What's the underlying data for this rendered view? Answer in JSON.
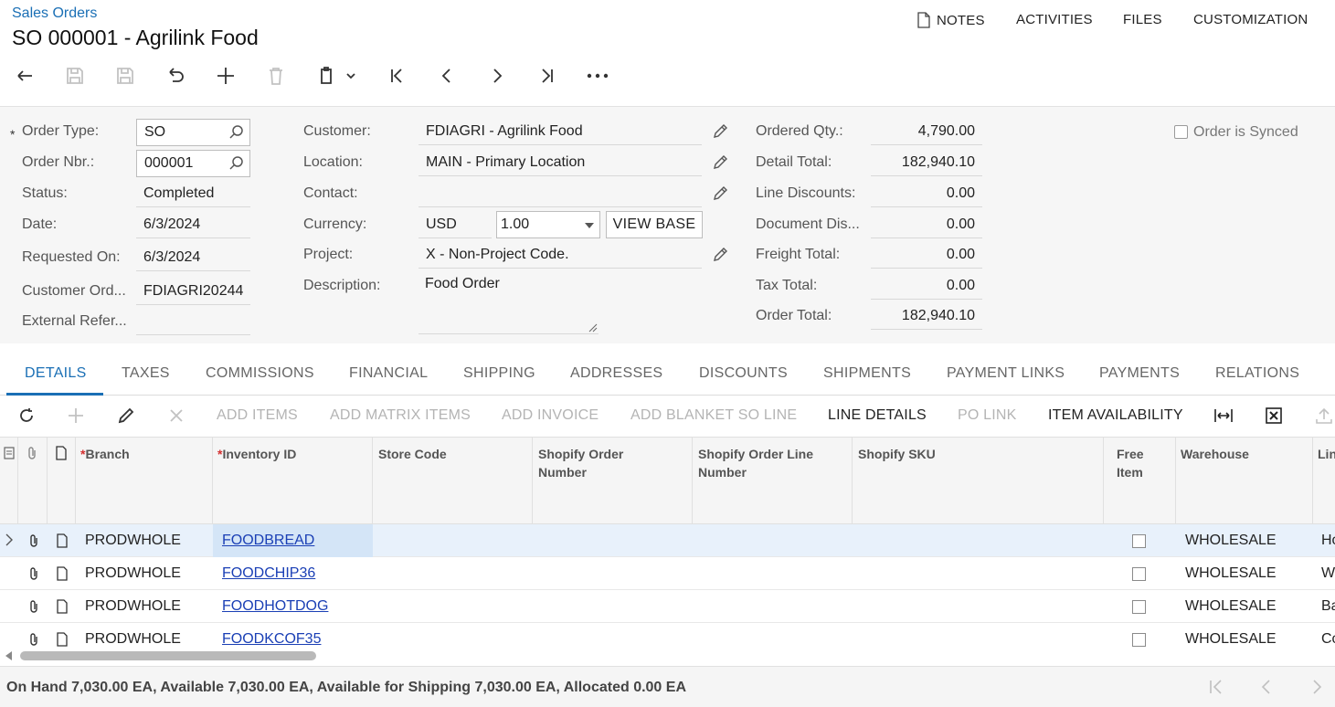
{
  "header": {
    "breadcrumb": "Sales Orders",
    "title": "SO 000001 - Agrilink Food",
    "nav": {
      "notes": "NOTES",
      "activities": "ACTIVITIES",
      "files": "FILES",
      "customization": "CUSTOMIZATION"
    }
  },
  "toolbar": {
    "icons": [
      "back-icon",
      "save-close-icon",
      "save-icon",
      "undo-icon",
      "add-icon",
      "delete-icon",
      "clipboard-icon",
      "first-icon",
      "prev-icon",
      "next-icon",
      "last-icon",
      "more-icon"
    ]
  },
  "form": {
    "order_type": {
      "label": "Order Type:",
      "required": "*",
      "value": "SO"
    },
    "order_nbr": {
      "label": "Order Nbr.:",
      "value": "000001"
    },
    "status": {
      "label": "Status:",
      "value": "Completed"
    },
    "date": {
      "label": "Date:",
      "value": "6/3/2024"
    },
    "requested_on": {
      "label": "Requested On:",
      "value": "6/3/2024"
    },
    "customer_order": {
      "label": "Customer Ord...",
      "value": "FDIAGRI20244"
    },
    "external_ref": {
      "label": "External Refer...",
      "value": ""
    },
    "customer": {
      "label": "Customer:",
      "value": "FDIAGRI - Agrilink Food"
    },
    "location": {
      "label": "Location:",
      "value": "MAIN - Primary Location"
    },
    "contact": {
      "label": "Contact:",
      "value": ""
    },
    "currency": {
      "label": "Currency:",
      "value": "USD",
      "rate": "1.00",
      "view_base": "VIEW BASE"
    },
    "project": {
      "label": "Project:",
      "value": "X - Non-Project Code."
    },
    "description": {
      "label": "Description:",
      "value": "Food Order"
    },
    "ordered_qty": {
      "label": "Ordered Qty.:",
      "value": "4,790.00"
    },
    "detail_total": {
      "label": "Detail Total:",
      "value": "182,940.10"
    },
    "line_discounts": {
      "label": "Line Discounts:",
      "value": "0.00"
    },
    "document_dis": {
      "label": "Document Dis...",
      "value": "0.00"
    },
    "freight_total": {
      "label": "Freight Total:",
      "value": "0.00"
    },
    "tax_total": {
      "label": "Tax Total:",
      "value": "0.00"
    },
    "order_total": {
      "label": "Order Total:",
      "value": "182,940.10"
    },
    "order_synced": {
      "label": "Order is Synced",
      "checked": false
    }
  },
  "tabs": [
    "DETAILS",
    "TAXES",
    "COMMISSIONS",
    "FINANCIAL",
    "SHIPPING",
    "ADDRESSES",
    "DISCOUNTS",
    "SHIPMENTS",
    "PAYMENT LINKS",
    "PAYMENTS",
    "RELATIONS"
  ],
  "active_tab": "DETAILS",
  "grid_toolbar": {
    "add_items": "ADD ITEMS",
    "add_matrix_items": "ADD MATRIX ITEMS",
    "add_invoice": "ADD INVOICE",
    "add_blanket": "ADD BLANKET SO LINE",
    "line_details": "LINE DETAILS",
    "po_link": "PO LINK",
    "item_availability": "ITEM AVAILABILITY"
  },
  "grid": {
    "columns": {
      "branch": "Branch",
      "inventory_id": "Inventory ID",
      "store_code": "Store Code",
      "shopify_order_1": "Shopify Order",
      "shopify_order_2": "Number",
      "shopify_line_1": "Shopify Order Line",
      "shopify_line_2": "Number",
      "shopify_sku": "Shopify SKU",
      "free_1": "Free",
      "free_2": "Item",
      "warehouse": "Warehouse",
      "line": "Lin"
    },
    "rows": [
      {
        "branch": "PRODWHOLE",
        "inventory_id": "FOODBREAD",
        "warehouse": "WHOLESALE",
        "line": "Ho"
      },
      {
        "branch": "PRODWHOLE",
        "inventory_id": "FOODCHIP36",
        "warehouse": "WHOLESALE",
        "line": "W"
      },
      {
        "branch": "PRODWHOLE",
        "inventory_id": "FOODHOTDOG",
        "warehouse": "WHOLESALE",
        "line": "Ba"
      },
      {
        "branch": "PRODWHOLE",
        "inventory_id": "FOODKCOF35",
        "warehouse": "WHOLESALE",
        "line": "Co"
      }
    ]
  },
  "footer": {
    "status_text": "On Hand 7,030.00 EA, Available 7,030.00 EA, Available for Shipping 7,030.00 EA, Allocated 0.00 EA"
  }
}
